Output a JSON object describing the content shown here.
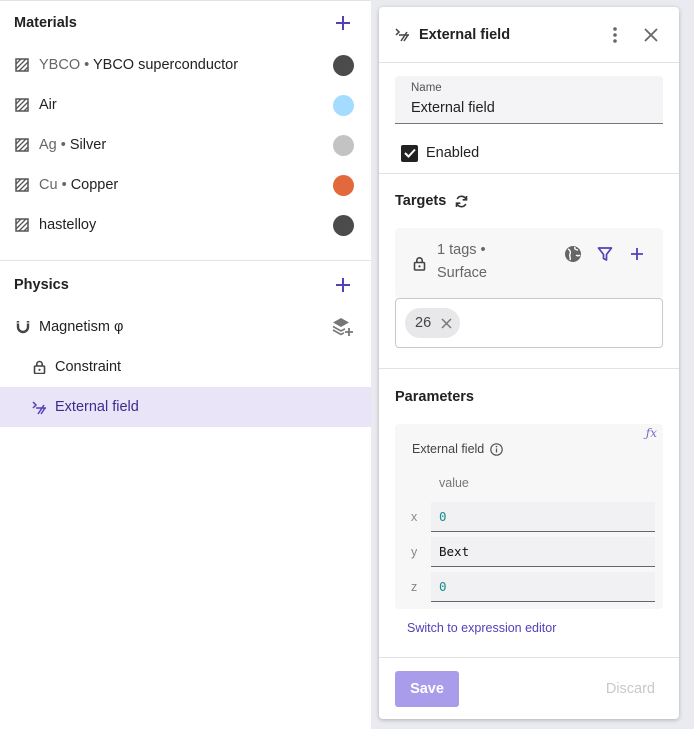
{
  "materials": {
    "title": "Materials",
    "items": [
      {
        "symbol": "YBCO",
        "sep": "•",
        "name": "YBCO superconductor",
        "color": "#4b4b4b"
      },
      {
        "symbol": "",
        "sep": "",
        "name": "Air",
        "color": "#a3dcff"
      },
      {
        "symbol": "Ag",
        "sep": "•",
        "name": "Silver",
        "color": "#c3c3c3"
      },
      {
        "symbol": "Cu",
        "sep": "•",
        "name": "Copper",
        "color": "#e2693b"
      },
      {
        "symbol": "",
        "sep": "",
        "name": "hastelloy",
        "color": "#4b4b4b"
      }
    ]
  },
  "physics": {
    "title": "Physics",
    "magnetism": "Magnetism φ",
    "constraint": "Constraint",
    "external_field": "External field"
  },
  "panel": {
    "title": "External field",
    "name_label": "Name",
    "name_value": "External field",
    "enabled_label": "Enabled",
    "targets_title": "Targets",
    "tags_line1": "1 tags •",
    "tags_line2": "Surface",
    "chip": "26",
    "parameters_title": "Parameters",
    "fx": "ƒx",
    "field_label": "External field",
    "value_header": "value",
    "rows": [
      {
        "axis": "x",
        "value": "0"
      },
      {
        "axis": "y",
        "value": "Bext"
      },
      {
        "axis": "z",
        "value": "0"
      }
    ],
    "switch_link": "Switch to expression editor",
    "save": "Save",
    "discard": "Discard"
  },
  "colors": {
    "accent": "#5540b8",
    "selected_bg": "#e9e4f8",
    "save_bg": "#a89ceb"
  }
}
